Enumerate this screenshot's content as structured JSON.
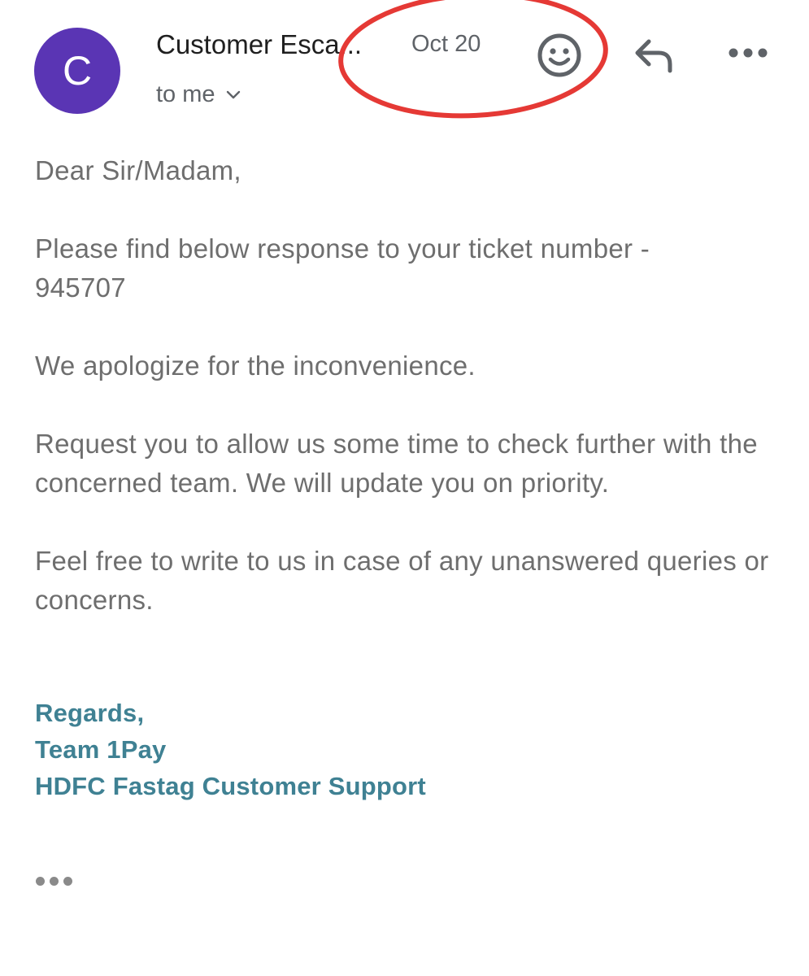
{
  "header": {
    "avatar_letter": "C",
    "sender_name": "Customer Esca...",
    "date": "Oct 20",
    "recipient": "to me"
  },
  "icons": {
    "recipient_toggle": "chevron-down-icon",
    "emoji": "smiley-icon",
    "reply": "reply-icon",
    "more": "more-horizontal-icon",
    "trimmed_content": "ellipsis-icon"
  },
  "body": {
    "greeting": "Dear Sir/Madam,",
    "paragraph_1_line_1": "Please find below response to your ticket number -",
    "paragraph_1_line_2": "945707",
    "paragraph_2": "We apologize for the inconvenience.",
    "paragraph_3": "Request you to allow us some time to check further with the concerned team. We will update you on priority.",
    "paragraph_4": "Feel free to write to us in case of any unanswered queries or concerns."
  },
  "signature": {
    "line_1": "Regards,",
    "line_2": "Team 1Pay",
    "line_3": "HDFC Fastag Customer Support"
  },
  "colors": {
    "avatar": "#5a35b4",
    "annotation_circle": "#e53935",
    "signature": "#3f8193",
    "body_text": "#6e6e6e"
  }
}
